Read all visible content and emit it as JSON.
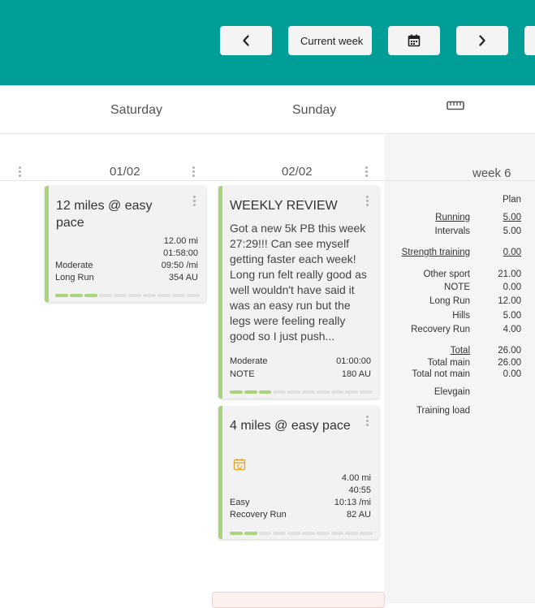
{
  "toolbar": {
    "prev_icon": "chevron-left-icon",
    "current_week_label": "Current week",
    "calendar_icon": "calendar-icon",
    "next_icon": "chevron-right-icon",
    "accent": "#009e96"
  },
  "days": {
    "saturday": "Saturday",
    "sunday": "Sunday",
    "ruler_icon": "ruler-icon"
  },
  "dates": {
    "saturday": "01/02",
    "sunday": "02/02",
    "week": "week 6"
  },
  "cards": {
    "sat_run": {
      "title": "12 miles @ easy pace",
      "distance": "12.00 mi",
      "duration": "01:58:00",
      "intensity": "Moderate",
      "pace": "09:50 /mi",
      "type": "Long Run",
      "load": "354 AU",
      "progress_segments": 3,
      "total_segments": 10
    },
    "sun_review": {
      "title": "WEEKLY REVIEW",
      "text": "Got a new 5k PB this week 27:29!!! Can see myself getting faster each week! Long run felt really good as well wouldn't have said it was an easy run but the legs were feeling really good so I just push...",
      "intensity": "Moderate",
      "duration": "01:00:00",
      "type": "NOTE",
      "load": "180 AU",
      "progress_segments": 3,
      "total_segments": 10
    },
    "sun_run": {
      "title": "4 miles @ easy pace",
      "status_icon": "calendar-sync-icon",
      "distance": "4.00 mi",
      "duration": "40:55",
      "intensity": "Easy",
      "pace": "10:13 /mi",
      "type": "Recovery Run",
      "load": "82 AU",
      "progress_segments": 2,
      "total_segments": 10
    }
  },
  "summary": {
    "plan_header": "Plan",
    "running_label": "Running",
    "running_value": "5.00",
    "intervals_label": "Intervals",
    "intervals_value": "5.00",
    "strength_label": "Strength training",
    "strength_value": "0.00",
    "other_sport_label": "Other sport",
    "other_sport_value": "21.00",
    "note_label": "NOTE",
    "note_value": "0.00",
    "long_run_label": "Long Run",
    "long_run_value": "12.00",
    "hills_label": "Hills",
    "hills_value": "5.00",
    "recovery_label": "Recovery Run",
    "recovery_value": "4.00",
    "total_label": "Total",
    "total_value": "26.00",
    "total_main_label": "Total main",
    "total_main_value": "26.00",
    "total_not_main_label": "Total not main",
    "total_not_main_value": "0.00",
    "elevgain_label": "Elevgain",
    "training_load_label": "Training load"
  }
}
